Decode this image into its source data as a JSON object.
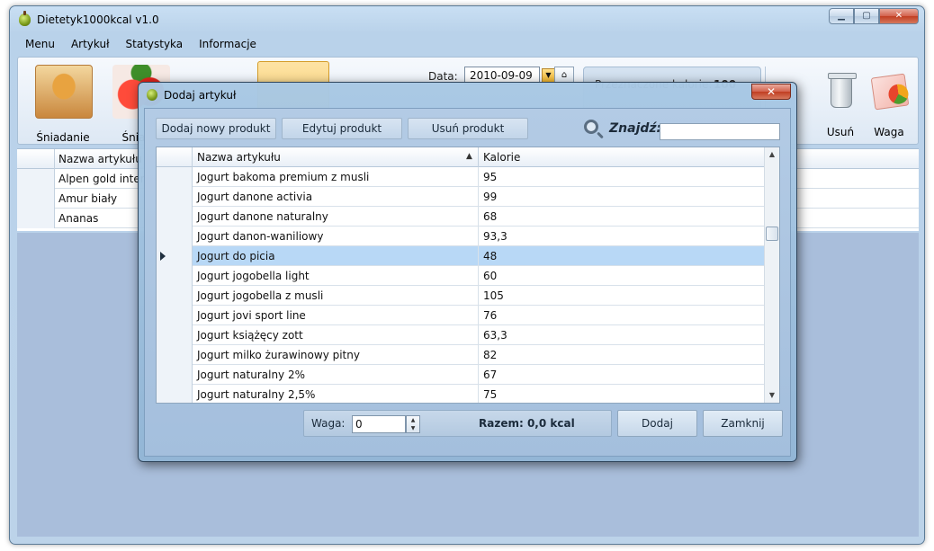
{
  "window": {
    "title": "Dietetyk1000kcal v1.0",
    "minimize_glyph": "▁",
    "maximize_glyph": "▢",
    "close_glyph": "✕"
  },
  "menu": [
    "Menu",
    "Artykuł",
    "Statystyka",
    "Informacje"
  ],
  "toolbar": {
    "meals": [
      {
        "label": "Śniadanie",
        "icon": "bread-jam-icon"
      },
      {
        "label": "Śniada",
        "icon": "strawberry-icon"
      }
    ],
    "date_label": "Data:",
    "date_value": "2010-09-09",
    "calorie_label": "Przeznaczone kalorie:",
    "calorie_value": "100",
    "delete_label": "Usuń",
    "weight_label": "Waga"
  },
  "main_grid": {
    "column_header": "Nazwa artykułu",
    "rows": [
      "Alpen gold inten",
      "Amur biały",
      "Ananas"
    ]
  },
  "dialog": {
    "title": "Dodaj artykuł",
    "close_glyph": "✕",
    "buttons": {
      "add_new": "Dodaj nowy produkt",
      "edit": "Edytuj produkt",
      "delete": "Usuń produkt"
    },
    "search_label": "Znajdź:",
    "search_value": "",
    "grid": {
      "columns": [
        "Nazwa artykułu",
        "Kalorie"
      ],
      "sort_glyph": "▲",
      "selected_index": 4,
      "rows": [
        {
          "name": "Jogurt bakoma premium z musli",
          "kcal": "95"
        },
        {
          "name": "Jogurt danone activia",
          "kcal": "99"
        },
        {
          "name": "Jogurt danone naturalny",
          "kcal": "68"
        },
        {
          "name": "Jogurt danon-waniliowy",
          "kcal": "93,3"
        },
        {
          "name": "Jogurt do picia",
          "kcal": "48"
        },
        {
          "name": "Jogurt jogobella light",
          "kcal": "60"
        },
        {
          "name": "Jogurt jogobella z musli",
          "kcal": "105"
        },
        {
          "name": "Jogurt jovi sport line",
          "kcal": "76"
        },
        {
          "name": "Jogurt książęcy zott",
          "kcal": "63,3"
        },
        {
          "name": "Jogurt milko żurawinowy pitny",
          "kcal": "82"
        },
        {
          "name": "Jogurt naturalny 2%",
          "kcal": "67"
        },
        {
          "name": "Jogurt naturalny 2,5%",
          "kcal": "75"
        }
      ]
    },
    "weight_label": "Waga:",
    "weight_value": "0",
    "total_text": "Razem: 0,0 kcal",
    "add_button": "Dodaj",
    "close_button": "Zamknij"
  }
}
